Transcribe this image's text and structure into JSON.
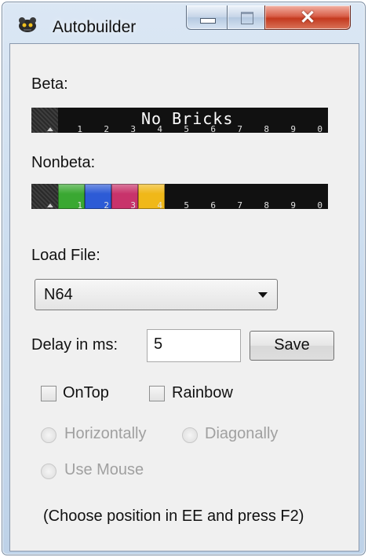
{
  "window": {
    "title": "Autobuilder",
    "icon": "gear-robot-icon",
    "minimize_icon": "minimize-icon",
    "maximize_icon": "maximize-icon",
    "close_icon": "close-icon"
  },
  "beta": {
    "label": "Beta:",
    "empty_text": "No Bricks",
    "slot_numbers": [
      "1",
      "2",
      "3",
      "4",
      "5",
      "6",
      "7",
      "8",
      "9",
      "0"
    ]
  },
  "nonbeta": {
    "label": "Nonbeta:",
    "slot_numbers": [
      "1",
      "2",
      "3",
      "4",
      "5",
      "6",
      "7",
      "8",
      "9",
      "0"
    ],
    "brick_colors": [
      "#3aa832",
      "#2d5bd6",
      "#c8336b",
      "#f0b819"
    ]
  },
  "load_file": {
    "label": "Load File:",
    "selected": "N64"
  },
  "delay": {
    "label": "Delay in ms:",
    "value": "5",
    "save_label": "Save"
  },
  "options": {
    "ontop_label": "OnTop",
    "rainbow_label": "Rainbow",
    "horizontally_label": "Horizontally",
    "diagonally_label": "Diagonally",
    "use_mouse_label": "Use Mouse"
  },
  "footer": {
    "hint": "(Choose position in EE and press F2)"
  }
}
